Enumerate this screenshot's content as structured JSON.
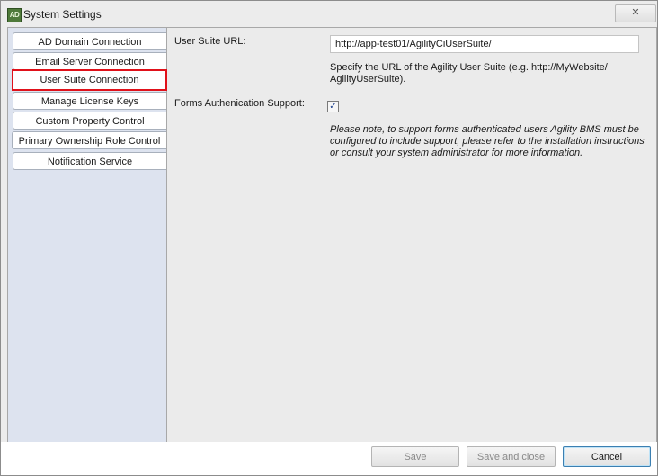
{
  "window": {
    "title": "System Settings",
    "icon_text": "AD",
    "close_glyph": "✕"
  },
  "sidebar": {
    "items": [
      {
        "label": "AD Domain Connection",
        "selected": false
      },
      {
        "label": "Email Server Connection",
        "selected": false
      },
      {
        "label": "User Suite Connection",
        "selected": true
      },
      {
        "label": "Manage License Keys",
        "selected": false
      },
      {
        "label": "Custom Property Control",
        "selected": false
      },
      {
        "label": "Primary Ownership Role Control",
        "selected": false
      },
      {
        "label": "Notification Service",
        "selected": false
      }
    ]
  },
  "main": {
    "url_label": "User Suite URL:",
    "url_value": "http://app-test01/AgilityCiUserSuite/",
    "url_help": "Specify the URL of the Agility User Suite (e.g. http://MyWebsite/ AgilityUserSuite).",
    "forms_label": "Forms Authenication Support:",
    "forms_checked": true,
    "checkbox_glyph": "✓",
    "note": "Please note, to support forms authenticated users Agility BMS must be configured to include support, please refer to the installation instructions or consult your system administrator for more information."
  },
  "footer": {
    "save_label": "Save",
    "save_close_label": "Save and close",
    "cancel_label": "Cancel"
  },
  "colors": {
    "selection_outline": "#e0111a",
    "sidebar_bg": "#dde3ef",
    "window_bg": "#ececec"
  }
}
